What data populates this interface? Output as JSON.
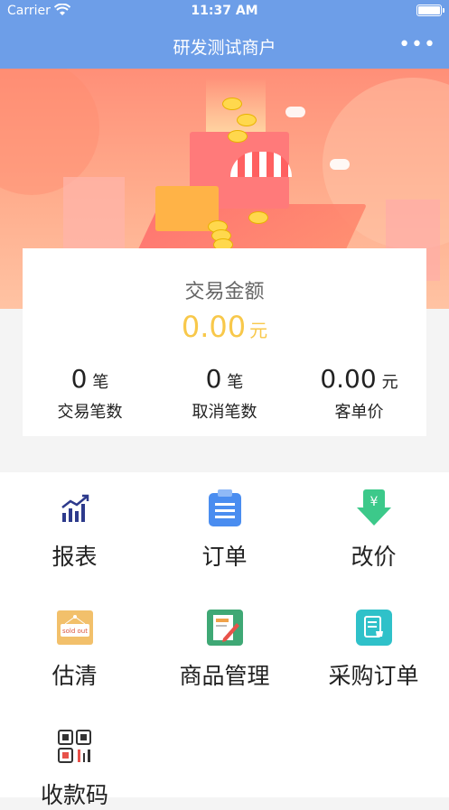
{
  "status_bar": {
    "carrier": "Carrier",
    "time": "11:37 AM"
  },
  "nav": {
    "title": "研发测试商户",
    "more_glyph": "•••"
  },
  "summary": {
    "label": "交易金额",
    "amount": "0.00",
    "amount_unit": "元",
    "stats": [
      {
        "value": "0",
        "unit": "笔",
        "name": "交易笔数"
      },
      {
        "value": "0",
        "unit": "笔",
        "name": "取消笔数"
      },
      {
        "value": "0.00",
        "unit": "元",
        "name": "客单价"
      }
    ]
  },
  "menu": [
    {
      "label": "报表",
      "icon": "bar-chart-icon"
    },
    {
      "label": "订单",
      "icon": "clipboard-icon"
    },
    {
      "label": "改价",
      "icon": "price-download-icon"
    },
    {
      "label": "估清",
      "icon": "sold-out-icon"
    },
    {
      "label": "商品管理",
      "icon": "product-edit-icon"
    },
    {
      "label": "采购订单",
      "icon": "purchase-order-icon"
    },
    {
      "label": "收款码",
      "icon": "qr-code-icon"
    }
  ],
  "sold_out_badge": "sold out",
  "colors": {
    "nav": "#6d9ee8",
    "amount": "#f8c84a",
    "accent_blue": "#4a8df0",
    "accent_green": "#3cc98a"
  }
}
